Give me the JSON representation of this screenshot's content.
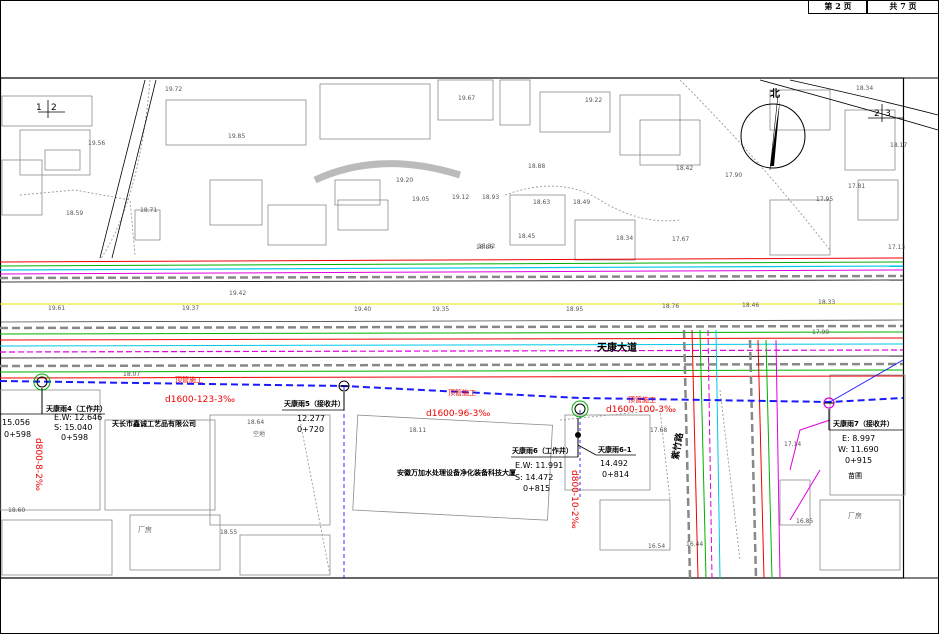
{
  "title_block": {
    "page": "第 2 页",
    "total": "共 7 页"
  },
  "north_label": "北",
  "match_lines": {
    "left": "1",
    "left2": "2",
    "right": "2",
    "right2": "3"
  },
  "road": {
    "name": "天康大道"
  },
  "side_road": {
    "name": "紫竹路"
  },
  "sections": [
    "顶管施工",
    "顶管施工",
    "顶管施工"
  ],
  "pipes": [
    {
      "label": "d1600-123-3‰"
    },
    {
      "label": "d1600-96-3‰"
    },
    {
      "label": "d1600-100-3‰"
    },
    {
      "label": "d800-10-2‰"
    },
    {
      "label": "d800-8-2‰"
    }
  ],
  "wells": [
    {
      "name": "天康雨4（工作井）",
      "lines": [
        "E.W: 12.646",
        "S: 15.040",
        "0+598"
      ]
    },
    {
      "name": "天康雨5（接收井）",
      "lines": [
        "12.277",
        "0+720"
      ]
    },
    {
      "name": "天康雨6（工作井）",
      "lines": [
        "E.W: 11.991",
        "S: 14.472",
        "0+815"
      ]
    },
    {
      "name": "天康雨6-1",
      "lines": [
        "14.492",
        "0+814"
      ]
    },
    {
      "name": "天康雨7（接收井）",
      "lines": [
        "E: 8.997",
        "W: 11.690",
        "0+915"
      ]
    }
  ],
  "left_stub": [
    "15.056",
    "0+598"
  ],
  "places": [
    "天长市鑫诚工艺品有限公司",
    "安徽万加水处理设备净化装备科技大厦",
    "厂房",
    "厂房",
    "苗圃",
    "空地"
  ],
  "spot_heights": [
    "19.72",
    "19.85",
    "19.67",
    "19.22",
    "19.56",
    "19.20",
    "19.05",
    "19.12",
    "18.93",
    "18.63",
    "18.49",
    "18.88",
    "18.42",
    "17.90",
    "17.67",
    "18.34",
    "18.17",
    "17.81",
    "19.42",
    "19.61",
    "19.37",
    "19.40",
    "19.35",
    "18.95",
    "18.76",
    "18.46",
    "18.33",
    "17.99",
    "17.13",
    "18.34",
    "18.86",
    "18.32",
    "18.45",
    "17.68",
    "16.54",
    "18.11",
    "18.60",
    "18.55",
    "16.44",
    "16.85",
    "17.14",
    "18.64",
    "18.07",
    "18.71",
    "18.59",
    "17.95"
  ]
}
